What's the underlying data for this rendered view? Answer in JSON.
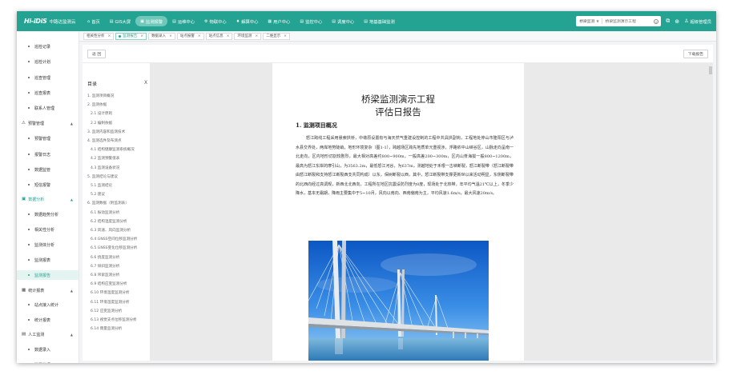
{
  "brand": {
    "mark": "Hi-iDiS",
    "name": "中路达监测云"
  },
  "nav": [
    {
      "icon": "⌂",
      "label": "首页"
    },
    {
      "icon": "▤",
      "label": "GIS大屏"
    },
    {
      "icon": "▣",
      "label": "监测报警"
    },
    {
      "icon": "▤",
      "label": "运维中心"
    },
    {
      "icon": "⚙",
      "label": "物联中心"
    },
    {
      "icon": "♦",
      "label": "解算中心"
    },
    {
      "icon": "▦",
      "label": "用户中心"
    },
    {
      "icon": "▤",
      "label": "监控中心"
    },
    {
      "icon": "▤",
      "label": "调度中心"
    },
    {
      "icon": "▤",
      "label": "地基基础监测"
    }
  ],
  "search": {
    "scope": "桥梁监测",
    "query": "桥梁监测演示工程"
  },
  "user": {
    "name": "超级管理员"
  },
  "sidebar": [
    {
      "type": "sub",
      "label": "巡检记录"
    },
    {
      "type": "sub",
      "label": "巡检计划"
    },
    {
      "type": "sub",
      "label": "巡查管理"
    },
    {
      "type": "sub",
      "label": "巡查报表"
    },
    {
      "type": "sub",
      "label": "联系人管理"
    },
    {
      "type": "group",
      "icon": "⚠",
      "label": "预警管理",
      "caret": "▲"
    },
    {
      "type": "sub",
      "label": "预警管理"
    },
    {
      "type": "sub",
      "label": "报警日志"
    },
    {
      "type": "sub",
      "label": "数据监管"
    },
    {
      "type": "sub",
      "label": "短信报警"
    },
    {
      "type": "group",
      "icon": "▣",
      "label": "数据分析",
      "caret": "▲",
      "open": true
    },
    {
      "type": "sub",
      "label": "数据趋势分析"
    },
    {
      "type": "sub",
      "label": "相关性分析"
    },
    {
      "type": "sub",
      "label": "监测体分析"
    },
    {
      "type": "sub",
      "label": "监测报表"
    },
    {
      "type": "sub",
      "label": "监测报告",
      "selected": true
    },
    {
      "type": "group",
      "icon": "▦",
      "label": "统计报表",
      "caret": "▲"
    },
    {
      "type": "sub",
      "label": "站点接入统计"
    },
    {
      "type": "sub",
      "label": "统计报表"
    },
    {
      "type": "group",
      "icon": "▤",
      "label": "人工监测",
      "caret": "▲"
    },
    {
      "type": "sub",
      "label": "数据录入"
    },
    {
      "type": "sub",
      "label": "测量数据"
    }
  ],
  "tabs": [
    {
      "label": "相关性分析"
    },
    {
      "label": "监测报告",
      "active": true
    },
    {
      "label": "数据录入"
    },
    {
      "label": "站点报警"
    },
    {
      "label": "站点信息"
    },
    {
      "label": "环境监测"
    },
    {
      "label": "二维显示"
    }
  ],
  "toolbar": {
    "back": "返 回",
    "download": "下载报告"
  },
  "toc": {
    "title": "目录",
    "close": "X",
    "items": [
      {
        "level": 1,
        "text": "1. 监测项目概况"
      },
      {
        "level": 1,
        "text": "2. 监测依据"
      },
      {
        "level": 2,
        "text": "2.1 设计原则"
      },
      {
        "level": 2,
        "text": "2.2 编制依据"
      },
      {
        "level": 1,
        "text": "3. 监测内容和监测技术"
      },
      {
        "level": 1,
        "text": "4. 监测选件及布测点"
      },
      {
        "level": 2,
        "text": "4.1 结构健康监测系统概况"
      },
      {
        "level": 2,
        "text": "4.2 监测预警值表"
      },
      {
        "level": 2,
        "text": "4.3 监测设备状况"
      },
      {
        "level": 1,
        "text": "5. 监测结论与建议"
      },
      {
        "level": 2,
        "text": "5.1 监测结论"
      },
      {
        "level": 2,
        "text": "5.2 建议"
      },
      {
        "level": 1,
        "text": "6. 监测数据（附监测表）"
      },
      {
        "level": 2,
        "text": "6.1 振动监测分析"
      },
      {
        "level": 2,
        "text": "6.2 结构温度监测分析"
      },
      {
        "level": 2,
        "text": "6.3 风速、风向监测分析"
      },
      {
        "level": 2,
        "text": "6.4 GNSS空间位移监测分析"
      },
      {
        "level": 2,
        "text": "6.5 GNSS变化位移监测分析"
      },
      {
        "level": 2,
        "text": "6.6 挠度监测分析"
      },
      {
        "level": 2,
        "text": "6.7 倾斜监测分析"
      },
      {
        "level": 2,
        "text": "6.8 吊索监测分析"
      },
      {
        "level": 2,
        "text": "6.9 结构应变监测分析"
      },
      {
        "level": 2,
        "text": "6.10 环境温度监测分析"
      },
      {
        "level": 2,
        "text": "6.11 环境湿度监测分析"
      },
      {
        "level": 2,
        "text": "6.12 应变监测分析"
      },
      {
        "level": 2,
        "text": "6.13 视觉支点位移监测分析"
      },
      {
        "level": 2,
        "text": "6.14 雨量监测分析"
      }
    ]
  },
  "document": {
    "title1": "桥梁监测演示工程",
    "title2": "评估日报告",
    "section1": "1.  监测项目概况",
    "paragraph": "怒江跨线工程采用悬索拱桥，中墩原设置有与海天然气重建设控制的工程中共具拱副钩，工程地处停山市隆阳区与泸水县交界处，两岸地势陡峭，地形环境复杂（图1-1），跨越场区跨先地质单元重视涉，浮路依中山峡谷区，山脉走向呈南一北走向，区内地形切割较剧烈，最大相对高差约800~900m，一般高差200~300m，区内山脊海拔一般800~1200m，最高为怒江东岸的摩引山，为3563.2m，最低怒江河谷，为637m，测越地处于禾根一古峡断裂，怒江断裂带（怒江断裂带由怒江断裂和支持怒江断裂西支共同构成）以东，保树断裂以西，其中，怒江断裂带支撑更新世以来活动明显，东侧断裂带的北西向经过高调规，新西北北西向，工程所在地区抗震设防烈度为8度，现场处于北热带，年平均气温21℃以上，冬季少降水，基本无霜期，降雨主要集中于5~10月，风向以南向、西南偏南为主，平均风速1.6m/s，最大风速20m/s。"
  },
  "colors": {
    "brand": "#24a392",
    "nav_active": "#6fc8b9",
    "sidebar_selected_bg": "#e4f4f1"
  }
}
